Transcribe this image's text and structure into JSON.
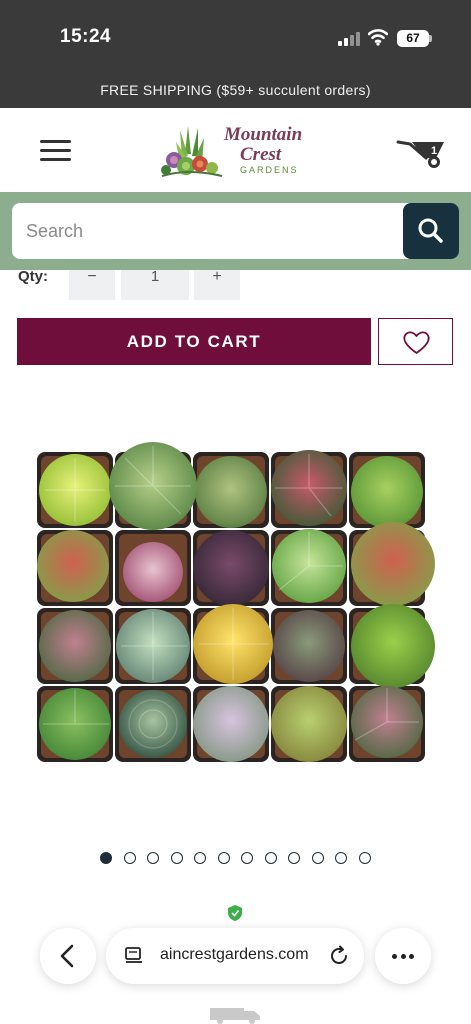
{
  "status_bar": {
    "time": "15:24",
    "battery": "67"
  },
  "announcement": {
    "text": "FREE SHIPPING ($59+ succulent orders)"
  },
  "header": {
    "logo": {
      "line1": "Mountain",
      "line2": "Crest",
      "line3": "GARDENS"
    },
    "cart_count": "1",
    "icons": {
      "menu": "hamburger-menu-icon",
      "cart": "wheelbarrow-cart-icon"
    }
  },
  "search": {
    "placeholder": "Search",
    "icon": "search-icon"
  },
  "quantity": {
    "label": "Qty:",
    "minus": "−",
    "value": "1",
    "plus": "+"
  },
  "actions": {
    "add_to_cart": "ADD TO CART",
    "wishlist_icon": "heart-icon"
  },
  "carousel": {
    "total_dots": 12,
    "active_index": 0
  },
  "browser": {
    "url": "aincrestgardens.com",
    "icons": [
      "back-arrow-icon",
      "page-icon",
      "reload-icon",
      "more-icon"
    ]
  },
  "colors": {
    "dark_bar": "#3a3a3a",
    "search_band": "#8cae8e",
    "search_button": "#17323e",
    "brand_maroon": "#6f0e3b"
  }
}
